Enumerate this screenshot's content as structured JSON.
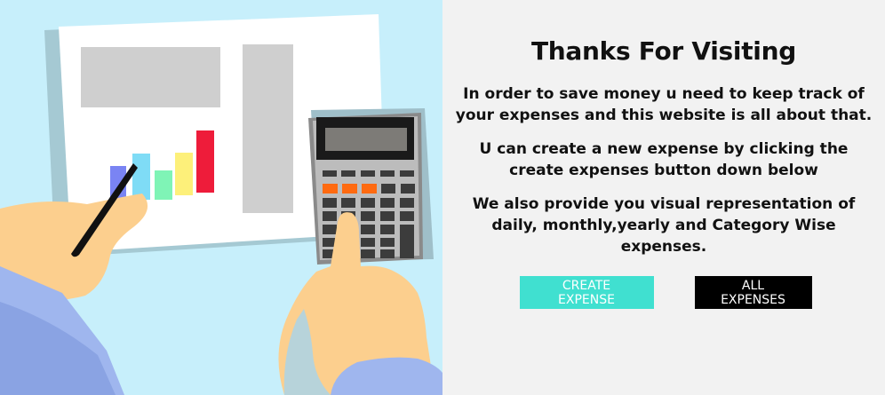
{
  "content": {
    "title": "Thanks For Visiting",
    "paragraph1": "In order to save money u need to keep track of your expenses and this website is all about that.",
    "paragraph2": "U can create a new expense by clicking the create expenses button down below",
    "paragraph3": "We also provide you visual representation of daily, monthly,yearly and Category Wise expenses."
  },
  "buttons": {
    "create_label": "CREATE EXPENSE",
    "all_label": "ALL EXPENSES"
  },
  "illustration": {
    "bar_colors": [
      "#7a84f3",
      "#7fdcf6",
      "#7ff4b6",
      "#fdf07a",
      "#ee1c3a"
    ],
    "colors": {
      "background": "#c7effb",
      "accent_button": "#40e0d0",
      "dark_button": "#000000"
    }
  }
}
